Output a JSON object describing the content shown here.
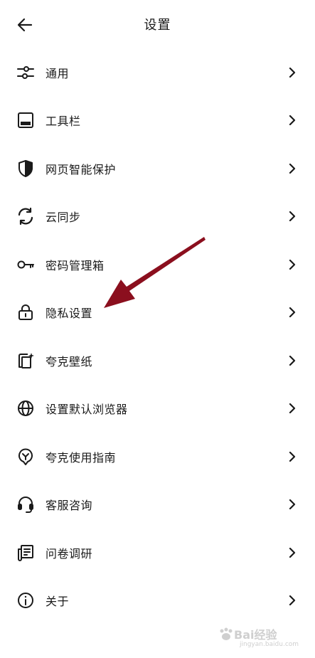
{
  "header": {
    "title": "设置"
  },
  "menu": [
    {
      "label": "通用",
      "icon": "sliders-icon"
    },
    {
      "label": "工具栏",
      "icon": "toolbar-icon"
    },
    {
      "label": "网页智能保护",
      "icon": "shield-icon"
    },
    {
      "label": "云同步",
      "icon": "sync-icon"
    },
    {
      "label": "密码管理箱",
      "icon": "key-icon"
    },
    {
      "label": "隐私设置",
      "icon": "lock-icon"
    },
    {
      "label": "夸克壁纸",
      "icon": "wallpaper-icon"
    },
    {
      "label": "设置默认浏览器",
      "icon": "globe-icon"
    },
    {
      "label": "夸克使用指南",
      "icon": "guide-icon"
    },
    {
      "label": "客服咨询",
      "icon": "headset-icon"
    },
    {
      "label": "问卷调研",
      "icon": "survey-icon"
    },
    {
      "label": "关于",
      "icon": "info-icon"
    }
  ],
  "watermark": {
    "brand": "Bai经验",
    "url": "jingyan.baidu.com"
  },
  "colors": {
    "annotation_arrow": "#8b0f1e",
    "text": "#1a1a1a"
  }
}
